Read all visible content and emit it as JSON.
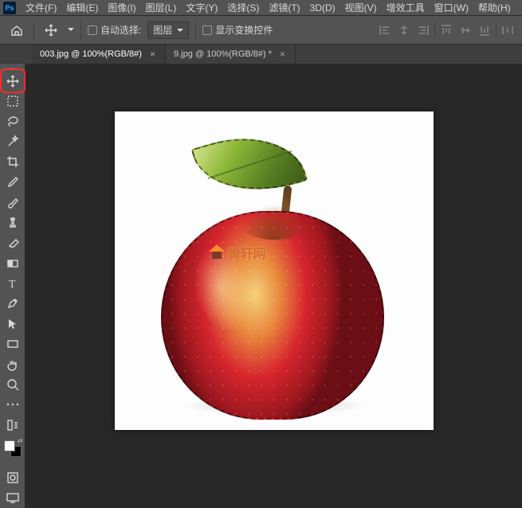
{
  "app": {
    "logo_text": "Ps"
  },
  "menu": {
    "file": "文件(F)",
    "edit": "编辑(E)",
    "image": "图像(I)",
    "layer": "图层(L)",
    "type": "文字(Y)",
    "select": "选择(S)",
    "filter": "滤镜(T)",
    "threeD": "3D(D)",
    "view": "视图(V)",
    "plugins": "增效工具",
    "window": "窗口(W)",
    "help": "帮助(H)"
  },
  "options": {
    "auto_select": "自动选择:",
    "auto_select_value": "图层",
    "show_transform": "显示变换控件"
  },
  "tabs": {
    "t1": "003.jpg @ 100%(RGB/8#)",
    "t2": "9.jpg @ 100%(RGB/8#) *"
  },
  "watermark": {
    "text": "腾轩网"
  }
}
